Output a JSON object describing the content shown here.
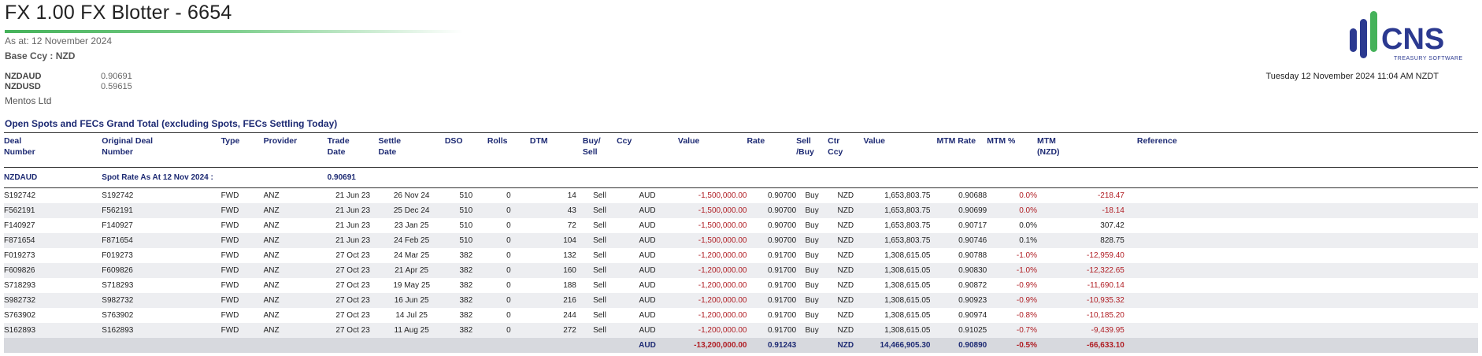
{
  "header": {
    "title": "FX 1.00 FX Blotter - 6654",
    "as_at": "As at: 12 November 2024",
    "base_ccy": "Base Ccy : NZD",
    "rates": [
      {
        "pair": "NZDAUD",
        "value": "0.90691"
      },
      {
        "pair": "NZDUSD",
        "value": "0.59615"
      }
    ],
    "client": "Mentos Ltd",
    "datetime": "Tuesday 12 November 2024 11:04 AM NZDT"
  },
  "logo": {
    "name": "CNS",
    "tagline": "TREASURY SOFTWARE",
    "colors": {
      "blue": "#2b3990",
      "green": "#45b25a"
    }
  },
  "section_title": "Open Spots and FECs Grand Total (excluding Spots, FECs Settling Today)",
  "columns": {
    "deal_number": [
      "Deal",
      "Number"
    ],
    "original_deal_number": [
      "Original Deal",
      "Number"
    ],
    "type": "Type",
    "provider": "Provider",
    "trade_date": [
      "Trade",
      "Date"
    ],
    "settle_date": [
      "Settle",
      "Date"
    ],
    "dso": "DSO",
    "rolls": "Rolls",
    "dtm": "DTM",
    "buy_sell": [
      "Buy/",
      "Sell"
    ],
    "ccy": "Ccy",
    "value": "Value",
    "rate": "Rate",
    "sell_buy": [
      "Sell",
      "/Buy"
    ],
    "ctr_ccy": [
      "Ctr",
      "Ccy"
    ],
    "ctr_value": "Value",
    "mtm_rate": "MTM Rate",
    "mtm_pct": "MTM %",
    "mtm": [
      "MTM",
      "(NZD)"
    ],
    "reference": "Reference"
  },
  "spot_row": {
    "pair": "NZDAUD",
    "label": "Spot Rate As At 12 Nov 2024 :",
    "rate": "0.90691"
  },
  "rows": [
    {
      "deal": "S192742",
      "orig": "S192742",
      "type": "FWD",
      "provider": "ANZ",
      "trade": "21 Jun 23",
      "settle": "26 Nov 24",
      "dso": "510",
      "rolls": "0",
      "dtm": "14",
      "bs": "Sell",
      "ccy": "AUD",
      "value": "-1,500,000.00",
      "rate": "0.90700",
      "sb": "Buy",
      "ctr": "NZD",
      "cval": "1,653,803.75",
      "mrate": "0.90688",
      "mpct": "0.0%",
      "mtm": "-218.47",
      "mpct_neg": true,
      "mtm_neg": true
    },
    {
      "deal": "F562191",
      "orig": "F562191",
      "type": "FWD",
      "provider": "ANZ",
      "trade": "21 Jun 23",
      "settle": "25 Dec 24",
      "dso": "510",
      "rolls": "0",
      "dtm": "43",
      "bs": "Sell",
      "ccy": "AUD",
      "value": "-1,500,000.00",
      "rate": "0.90700",
      "sb": "Buy",
      "ctr": "NZD",
      "cval": "1,653,803.75",
      "mrate": "0.90699",
      "mpct": "0.0%",
      "mtm": "-18.14",
      "mpct_neg": true,
      "mtm_neg": true
    },
    {
      "deal": "F140927",
      "orig": "F140927",
      "type": "FWD",
      "provider": "ANZ",
      "trade": "21 Jun 23",
      "settle": "23 Jan 25",
      "dso": "510",
      "rolls": "0",
      "dtm": "72",
      "bs": "Sell",
      "ccy": "AUD",
      "value": "-1,500,000.00",
      "rate": "0.90700",
      "sb": "Buy",
      "ctr": "NZD",
      "cval": "1,653,803.75",
      "mrate": "0.90717",
      "mpct": "0.0%",
      "mtm": "307.42",
      "mpct_neg": false,
      "mtm_neg": false
    },
    {
      "deal": "F871654",
      "orig": "F871654",
      "type": "FWD",
      "provider": "ANZ",
      "trade": "21 Jun 23",
      "settle": "24 Feb 25",
      "dso": "510",
      "rolls": "0",
      "dtm": "104",
      "bs": "Sell",
      "ccy": "AUD",
      "value": "-1,500,000.00",
      "rate": "0.90700",
      "sb": "Buy",
      "ctr": "NZD",
      "cval": "1,653,803.75",
      "mrate": "0.90746",
      "mpct": "0.1%",
      "mtm": "828.75",
      "mpct_neg": false,
      "mtm_neg": false
    },
    {
      "deal": "F019273",
      "orig": "F019273",
      "type": "FWD",
      "provider": "ANZ",
      "trade": "27 Oct 23",
      "settle": "24 Mar 25",
      "dso": "382",
      "rolls": "0",
      "dtm": "132",
      "bs": "Sell",
      "ccy": "AUD",
      "value": "-1,200,000.00",
      "rate": "0.91700",
      "sb": "Buy",
      "ctr": "NZD",
      "cval": "1,308,615.05",
      "mrate": "0.90788",
      "mpct": "-1.0%",
      "mtm": "-12,959.40",
      "mpct_neg": true,
      "mtm_neg": true
    },
    {
      "deal": "F609826",
      "orig": "F609826",
      "type": "FWD",
      "provider": "ANZ",
      "trade": "27 Oct 23",
      "settle": "21 Apr 25",
      "dso": "382",
      "rolls": "0",
      "dtm": "160",
      "bs": "Sell",
      "ccy": "AUD",
      "value": "-1,200,000.00",
      "rate": "0.91700",
      "sb": "Buy",
      "ctr": "NZD",
      "cval": "1,308,615.05",
      "mrate": "0.90830",
      "mpct": "-1.0%",
      "mtm": "-12,322.65",
      "mpct_neg": true,
      "mtm_neg": true
    },
    {
      "deal": "S718293",
      "orig": "S718293",
      "type": "FWD",
      "provider": "ANZ",
      "trade": "27 Oct 23",
      "settle": "19 May 25",
      "dso": "382",
      "rolls": "0",
      "dtm": "188",
      "bs": "Sell",
      "ccy": "AUD",
      "value": "-1,200,000.00",
      "rate": "0.91700",
      "sb": "Buy",
      "ctr": "NZD",
      "cval": "1,308,615.05",
      "mrate": "0.90872",
      "mpct": "-0.9%",
      "mtm": "-11,690.14",
      "mpct_neg": true,
      "mtm_neg": true
    },
    {
      "deal": "S982732",
      "orig": "S982732",
      "type": "FWD",
      "provider": "ANZ",
      "trade": "27 Oct 23",
      "settle": "16 Jun 25",
      "dso": "382",
      "rolls": "0",
      "dtm": "216",
      "bs": "Sell",
      "ccy": "AUD",
      "value": "-1,200,000.00",
      "rate": "0.91700",
      "sb": "Buy",
      "ctr": "NZD",
      "cval": "1,308,615.05",
      "mrate": "0.90923",
      "mpct": "-0.9%",
      "mtm": "-10,935.32",
      "mpct_neg": true,
      "mtm_neg": true
    },
    {
      "deal": "S763902",
      "orig": "S763902",
      "type": "FWD",
      "provider": "ANZ",
      "trade": "27 Oct 23",
      "settle": "14 Jul 25",
      "dso": "382",
      "rolls": "0",
      "dtm": "244",
      "bs": "Sell",
      "ccy": "AUD",
      "value": "-1,200,000.00",
      "rate": "0.91700",
      "sb": "Buy",
      "ctr": "NZD",
      "cval": "1,308,615.05",
      "mrate": "0.90974",
      "mpct": "-0.8%",
      "mtm": "-10,185.20",
      "mpct_neg": true,
      "mtm_neg": true
    },
    {
      "deal": "S162893",
      "orig": "S162893",
      "type": "FWD",
      "provider": "ANZ",
      "trade": "27 Oct 23",
      "settle": "11 Aug 25",
      "dso": "382",
      "rolls": "0",
      "dtm": "272",
      "bs": "Sell",
      "ccy": "AUD",
      "value": "-1,200,000.00",
      "rate": "0.91700",
      "sb": "Buy",
      "ctr": "NZD",
      "cval": "1,308,615.05",
      "mrate": "0.91025",
      "mpct": "-0.7%",
      "mtm": "-9,439.95",
      "mpct_neg": true,
      "mtm_neg": true
    }
  ],
  "total": {
    "ccy": "AUD",
    "value": "-13,200,000.00",
    "rate": "0.91243",
    "ctr": "NZD",
    "cval": "14,466,905.30",
    "mrate": "0.90890",
    "mpct": "-0.5%",
    "mtm": "-66,633.10"
  },
  "colors": {
    "negative": "#b01e24",
    "header_text": "#1d2a73",
    "alt_row": "#edeef1",
    "total_row": "#d7d9de"
  }
}
